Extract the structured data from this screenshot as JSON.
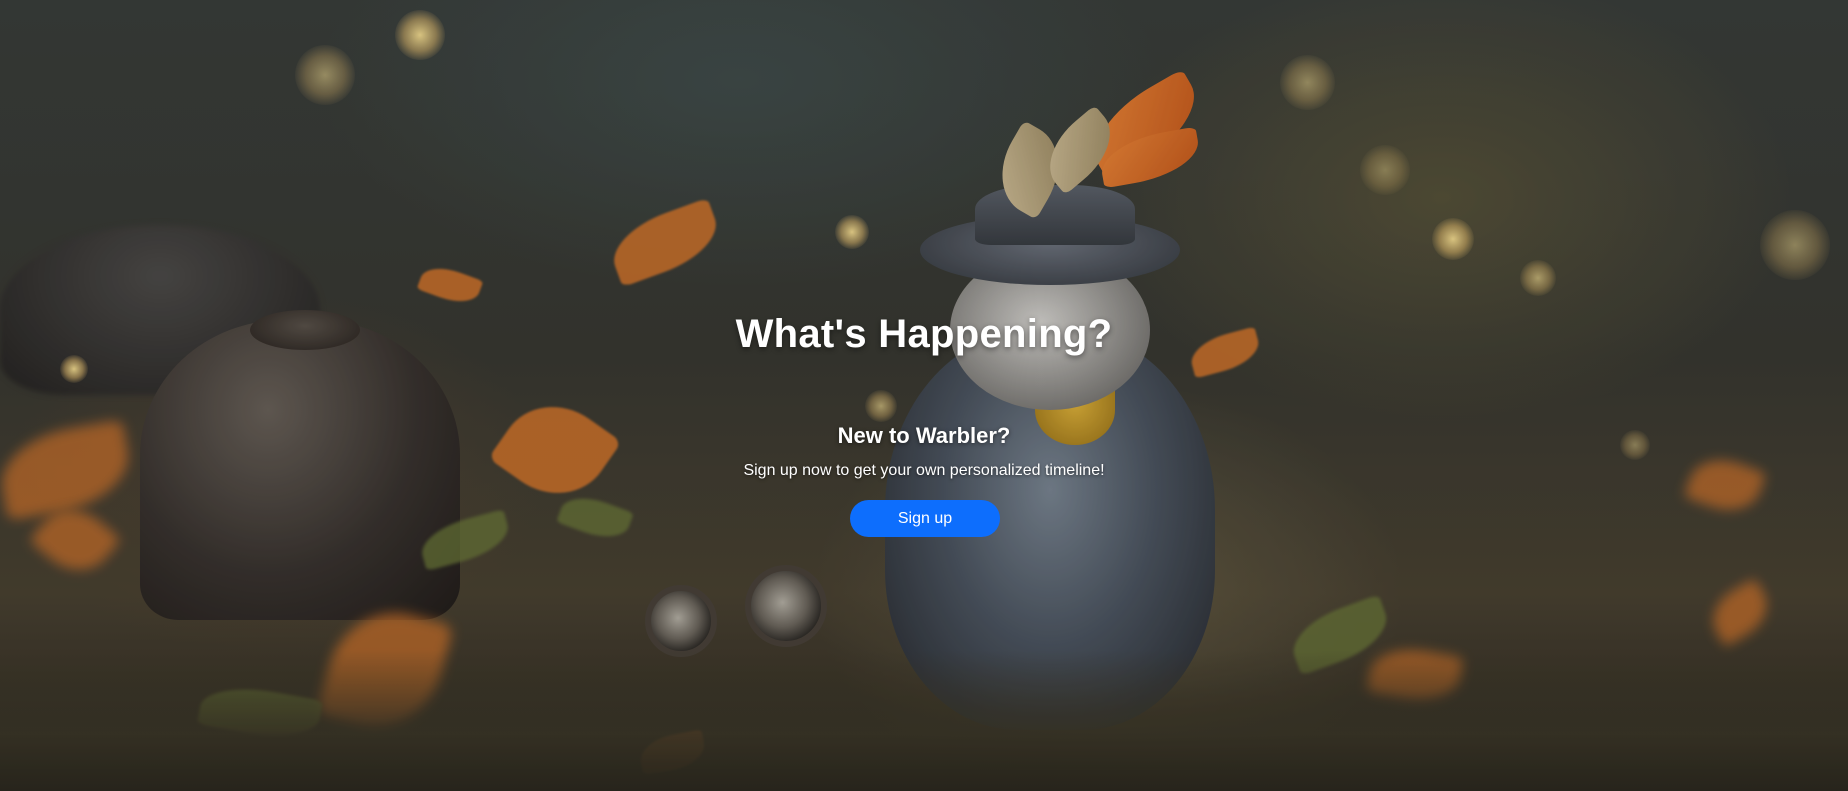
{
  "hero": {
    "headline": "What's Happening?",
    "subheading": "New to Warbler?",
    "tagline": "Sign up now to get your own personalized timeline!",
    "signup_label": "Sign up",
    "background_image": "steampunk-bird-autumn-scene"
  },
  "colors": {
    "primary_button": "#0d6efd",
    "text": "#ffffff"
  }
}
